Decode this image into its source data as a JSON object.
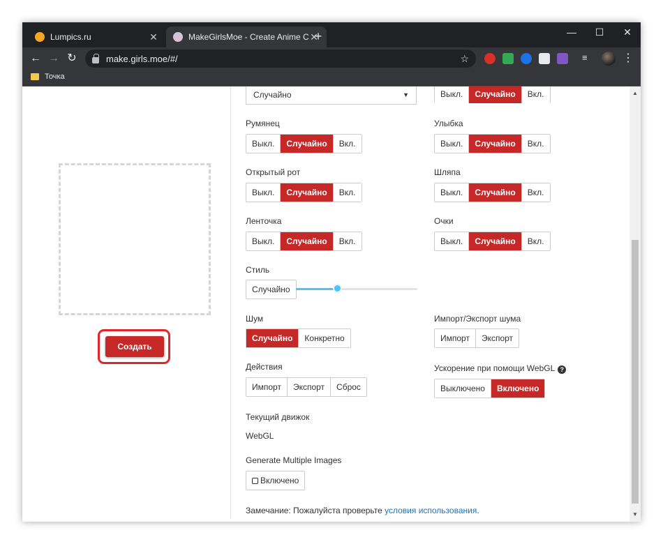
{
  "tabs": [
    {
      "title": "Lumpics.ru"
    },
    {
      "title": "MakeGirlsMoe - Create Anime Ch"
    }
  ],
  "address_bar": {
    "url": "make.girls.moe/#/"
  },
  "bookmarks": [
    {
      "label": "Точка"
    }
  ],
  "generator": {
    "create_label": "Создать"
  },
  "options": {
    "dropdown": {
      "value": "Случайно"
    },
    "top_right_group": {
      "selected": "Случайно",
      "values": [
        "Выкл.",
        "Случайно",
        "Вкл."
      ]
    },
    "blush": {
      "label": "Румянец",
      "values": [
        "Выкл.",
        "Случайно",
        "Вкл."
      ],
      "selected": "Случайно"
    },
    "smile": {
      "label": "Улыбка",
      "values": [
        "Выкл.",
        "Случайно",
        "Вкл."
      ],
      "selected": "Случайно"
    },
    "open_mouth": {
      "label": "Открытый рот",
      "values": [
        "Выкл.",
        "Случайно",
        "Вкл."
      ],
      "selected": "Случайно"
    },
    "hat": {
      "label": "Шляпа",
      "values": [
        "Выкл.",
        "Случайно",
        "Вкл."
      ],
      "selected": "Случайно"
    },
    "ribbon": {
      "label": "Ленточка",
      "values": [
        "Выкл.",
        "Случайно",
        "Вкл."
      ],
      "selected": "Случайно"
    },
    "glasses": {
      "label": "Очки",
      "values": [
        "Выкл.",
        "Случайно",
        "Вкл."
      ],
      "selected": "Случайно"
    },
    "style": {
      "label": "Стиль",
      "button": "Случайно",
      "slider_value": 0.34
    },
    "noise": {
      "label": "Шум",
      "values": [
        "Случайно",
        "Конкретно"
      ],
      "selected": "Случайно"
    },
    "noise_io": {
      "label": "Импорт/Экспорт шума",
      "values": [
        "Импорт",
        "Экспорт"
      ]
    },
    "actions": {
      "label": "Действия",
      "values": [
        "Импорт",
        "Экспорт",
        "Сброс"
      ]
    },
    "webgl": {
      "label": "Ускорение при помощи WebGL",
      "help": "?",
      "values": [
        "Выключено",
        "Включено"
      ],
      "selected": "Включено"
    },
    "engine": {
      "label": "Текущий движок",
      "value": "WebGL"
    },
    "multiple": {
      "label": "Generate Multiple Images",
      "button": "Включено"
    },
    "note": {
      "prefix": "Замечание: Пожалуйста проверьте ",
      "link": "условия использования",
      "suffix": "."
    }
  },
  "colors": {
    "accent": "#c62828",
    "slider": "#4fc3f7",
    "highlight": "#e0252b"
  }
}
